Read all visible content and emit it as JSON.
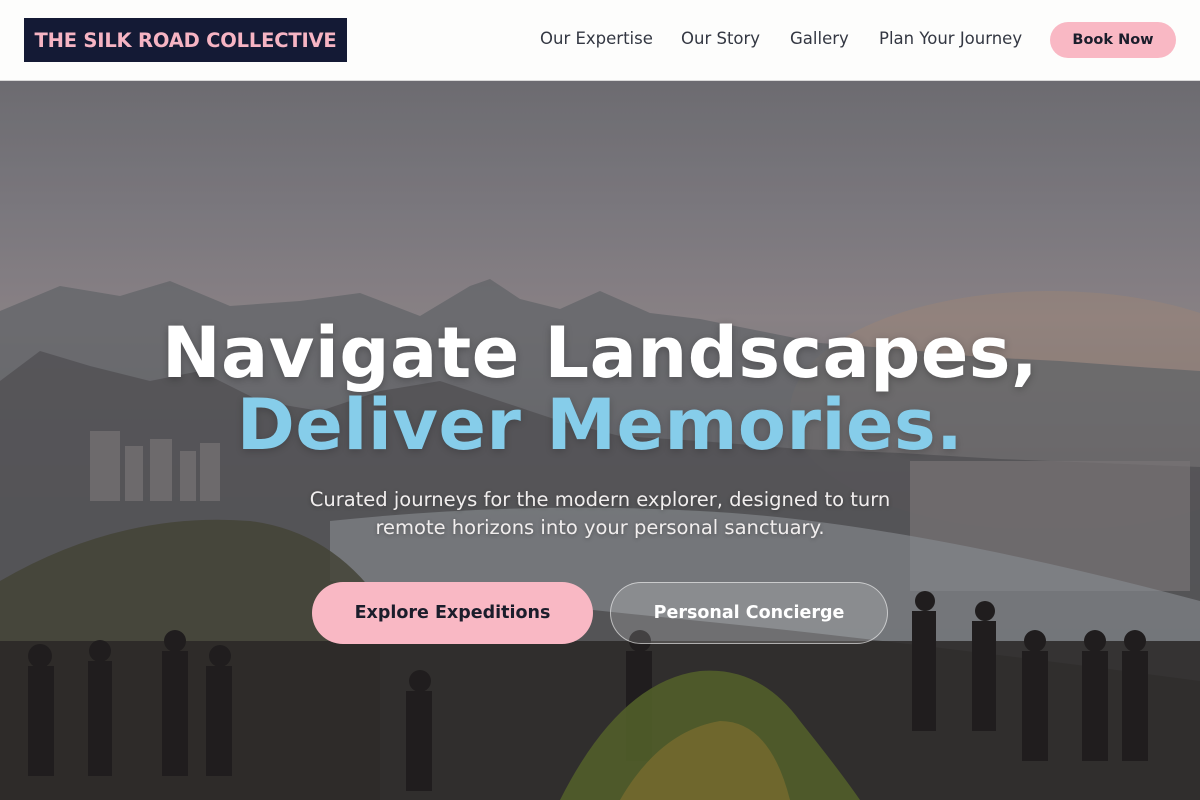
{
  "header": {
    "brand": "THE SILK ROAD COLLECTIVE",
    "nav": [
      {
        "label": "Our Expertise"
      },
      {
        "label": "Our Story"
      },
      {
        "label": "Gallery"
      },
      {
        "label": "Plan Your Journey"
      }
    ],
    "book_label": "Book Now"
  },
  "hero": {
    "headline_line1": "Navigate Landscapes,",
    "headline_line2": "Deliver Memories.",
    "subtitle": "Curated journeys for the modern explorer, designed to turn remote horizons into your personal sanctuary.",
    "primary_cta": "Explore Expeditions",
    "secondary_cta": "Personal Concierge",
    "background_image": "crowd at a mountain lookout over a coastal city and bay at dusk"
  },
  "colors": {
    "brand_navy": "#141a35",
    "accent_pink": "#f9b8c4",
    "accent_blue": "#86cdea"
  }
}
